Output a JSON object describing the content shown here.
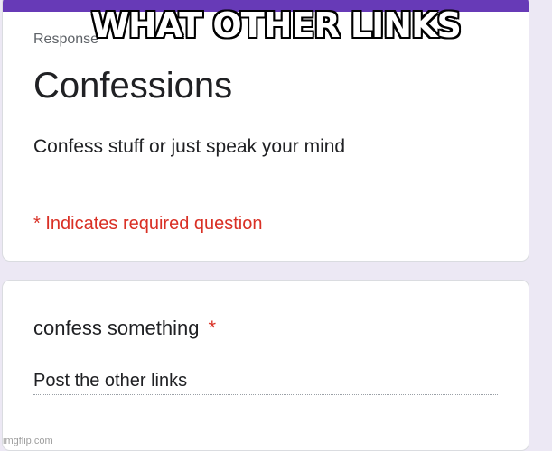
{
  "form": {
    "header_meta": "Response",
    "title": "Confessions",
    "description": "Confess stuff or just speak your mind",
    "required_note": "* Indicates required question",
    "accent_color": "#673ab7"
  },
  "question": {
    "title": "confess something",
    "required_marker": "*",
    "answer": "Post the other links"
  },
  "meme": {
    "caption": "WHAT OTHER LINKS",
    "watermark": "imgflip.com"
  }
}
